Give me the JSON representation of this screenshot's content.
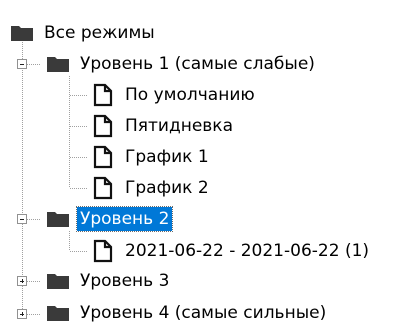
{
  "tree": {
    "root": {
      "label": "Все режимы",
      "icon": "folder-icon",
      "expanded": true
    },
    "levels": [
      {
        "label": "Уровень 1 (самые слабые)",
        "icon": "folder-icon",
        "expanded": true,
        "selected": false,
        "children": [
          {
            "label": "По умолчанию",
            "icon": "document-icon"
          },
          {
            "label": "Пятидневка",
            "icon": "document-icon"
          },
          {
            "label": "График 1",
            "icon": "document-icon"
          },
          {
            "label": "График 2",
            "icon": "document-icon"
          }
        ]
      },
      {
        "label": "Уровень 2",
        "icon": "folder-icon",
        "expanded": true,
        "selected": true,
        "children": [
          {
            "label": "2021-06-22 - 2021-06-22 (1)",
            "icon": "document-icon"
          }
        ]
      },
      {
        "label": "Уровень 3",
        "icon": "folder-icon",
        "expanded": false,
        "selected": false
      },
      {
        "label": "Уровень 4 (самые сильные)",
        "icon": "folder-icon",
        "expanded": false,
        "selected": false
      }
    ]
  },
  "colors": {
    "selection": "#0078d7",
    "folder": "#3a3a3a",
    "lines": "#a0a0a0"
  }
}
